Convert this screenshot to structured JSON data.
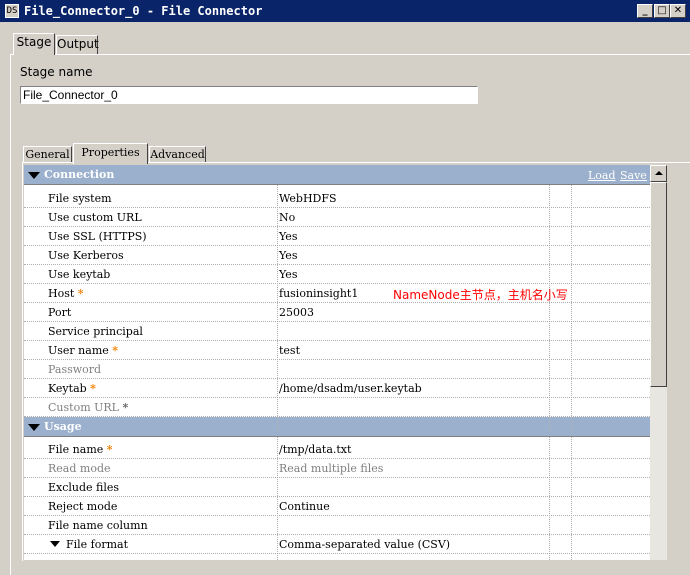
{
  "window": {
    "icon_text": "DS",
    "title": "File_Connector_0 - File Connector"
  },
  "outer_tabs": [
    {
      "label": "Stage",
      "active": true
    },
    {
      "label": "Output",
      "active": false
    }
  ],
  "stage": {
    "label": "Stage name",
    "value": "File_Connector_0"
  },
  "inner_tabs": [
    {
      "label": "General",
      "active": false
    },
    {
      "label": "Properties",
      "active": true
    },
    {
      "label": "Advanced",
      "active": false
    }
  ],
  "connection": {
    "title": "Connection",
    "load": "Load",
    "save": "Save",
    "rows": [
      {
        "name": "File system",
        "value": "WebHDFS",
        "required": false,
        "enabled": true
      },
      {
        "name": "Use custom URL",
        "value": "No",
        "required": false,
        "enabled": true
      },
      {
        "name": "Use SSL (HTTPS)",
        "value": "Yes",
        "required": false,
        "enabled": true
      },
      {
        "name": "Use Kerberos",
        "value": "Yes",
        "required": false,
        "enabled": true
      },
      {
        "name": "Use keytab",
        "value": "Yes",
        "required": false,
        "enabled": true
      },
      {
        "name": "Host",
        "value": "fusioninsight1",
        "required": true,
        "enabled": true
      },
      {
        "name": "Port",
        "value": "25003",
        "required": false,
        "enabled": true
      },
      {
        "name": "Service principal",
        "value": "",
        "required": false,
        "enabled": true
      },
      {
        "name": "User name",
        "value": "test",
        "required": true,
        "enabled": true
      },
      {
        "name": "Password",
        "value": "",
        "required": false,
        "enabled": false
      },
      {
        "name": "Keytab",
        "value": "/home/dsadm/user.keytab",
        "required": true,
        "enabled": true
      },
      {
        "name": "Custom URL",
        "value": "",
        "required": true,
        "enabled": false
      }
    ]
  },
  "usage": {
    "title": "Usage",
    "rows": [
      {
        "name": "File name",
        "value": "/tmp/data.txt",
        "required": true,
        "enabled": true
      },
      {
        "name": "Read mode",
        "value": "Read multiple files",
        "required": false,
        "enabled": false
      },
      {
        "name": "Exclude files",
        "value": "",
        "required": false,
        "enabled": true
      },
      {
        "name": "Reject mode",
        "value": "Continue",
        "required": false,
        "enabled": true
      },
      {
        "name": "File name column",
        "value": "",
        "required": false,
        "enabled": true
      },
      {
        "name": "File format",
        "value": "Comma-separated value (CSV)",
        "required": false,
        "enabled": true
      }
    ]
  },
  "annotation": "NameNode主节点，主机名小写",
  "required_marker": "*"
}
